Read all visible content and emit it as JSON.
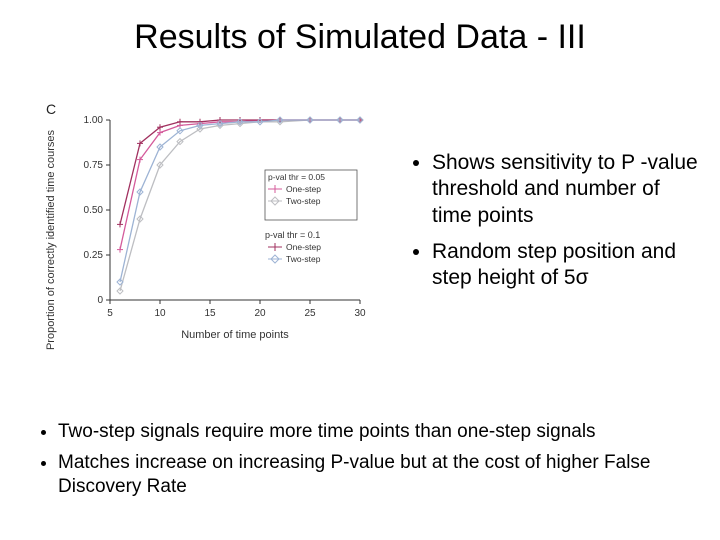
{
  "title": "Results of Simulated Data - III",
  "right": {
    "b1": "Shows sensitivity to P -value threshold and number of time points",
    "b2": "Random step position and step height of 5σ"
  },
  "bottom": {
    "b1": "Two-step signals require more time points than one-step signals",
    "b2": "Matches increase on increasing P-value but at the cost of higher False Discovery Rate"
  },
  "chart_data": {
    "type": "line",
    "title": "",
    "panel_label": "C",
    "xlabel": "Number of time points",
    "ylabel": "Proportion of correctly identified time courses",
    "xlim": [
      5,
      30
    ],
    "ylim": [
      0,
      1.0
    ],
    "x_ticks": [
      5,
      10,
      15,
      20,
      25,
      30
    ],
    "y_ticks": [
      0,
      0.25,
      0.5,
      0.75,
      1.0
    ],
    "x": [
      6,
      8,
      10,
      12,
      14,
      16,
      18,
      20,
      22,
      25,
      28,
      30
    ],
    "legend_groups": [
      {
        "header": "p-val thr = 0.05",
        "items": [
          "One-step",
          "Two-step"
        ]
      },
      {
        "header": "p-val thr = 0.1",
        "items": [
          "One-step",
          "Two-step"
        ]
      }
    ],
    "series": [
      {
        "name": "One-step p=0.05",
        "marker": "plus",
        "color": "#d45b9b",
        "values": [
          0.28,
          0.78,
          0.93,
          0.97,
          0.98,
          0.99,
          0.99,
          1.0,
          1.0,
          1.0,
          1.0,
          1.0
        ]
      },
      {
        "name": "Two-step p=0.05",
        "marker": "diamond",
        "color": "#bdbec2",
        "values": [
          0.05,
          0.45,
          0.75,
          0.88,
          0.95,
          0.97,
          0.98,
          0.99,
          0.99,
          1.0,
          1.0,
          1.0
        ]
      },
      {
        "name": "One-step p=0.1",
        "marker": "plus",
        "color": "#a1305f",
        "values": [
          0.42,
          0.87,
          0.96,
          0.99,
          0.99,
          1.0,
          1.0,
          1.0,
          1.0,
          1.0,
          1.0,
          1.0
        ]
      },
      {
        "name": "Two-step p=0.1",
        "marker": "diamond",
        "color": "#9db3d4",
        "values": [
          0.1,
          0.6,
          0.85,
          0.94,
          0.97,
          0.98,
          0.99,
          0.99,
          1.0,
          1.0,
          1.0,
          1.0
        ]
      }
    ]
  }
}
